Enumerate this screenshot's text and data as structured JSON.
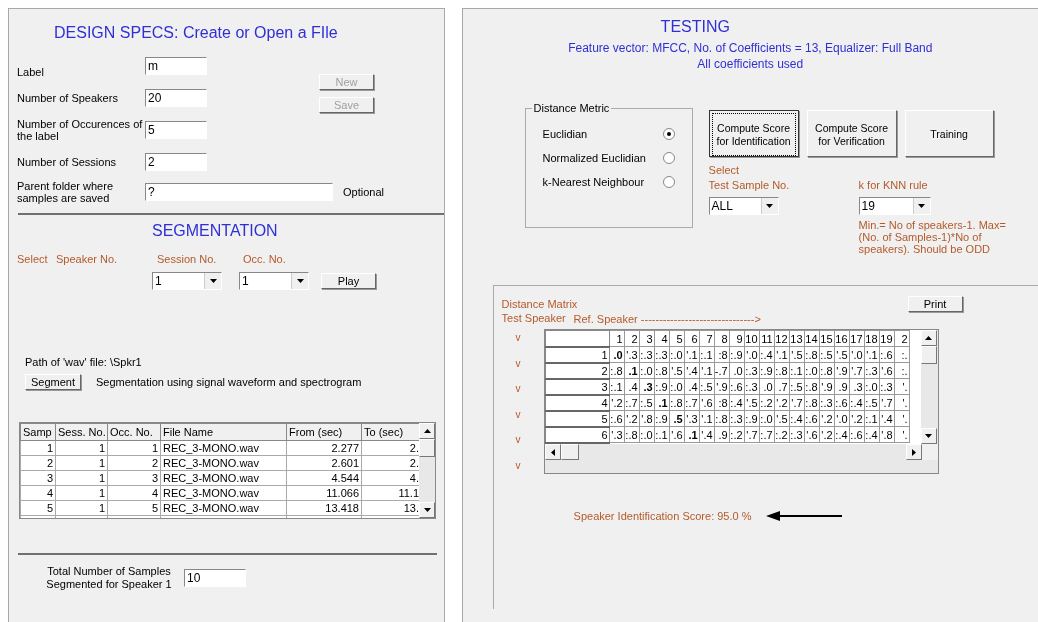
{
  "design_specs": {
    "title": "DESIGN SPECS: Create or Open a FIle",
    "fields": [
      {
        "label": "Label",
        "value": "m"
      },
      {
        "label": "Number of Speakers",
        "value": "20"
      },
      {
        "label": "Number of Occurences of the label",
        "value": "5"
      },
      {
        "label": "Number of Sessions",
        "value": "2"
      }
    ],
    "buttons": [
      {
        "label": "New",
        "disabled": true
      },
      {
        "label": "Save",
        "disabled": true
      }
    ],
    "parent_folder": {
      "label": "Parent folder where samples are saved",
      "value": "?",
      "note": "Optional"
    }
  },
  "segmentation": {
    "title": "SEGMENTATION",
    "select_label": "Select",
    "speaker_label": "Speaker No.",
    "session_label": "Session No.",
    "occ_label": "Occ. No.",
    "session_value": "1",
    "occ_value": "1",
    "play_button": "Play",
    "path_text": "Path of 'wav' file:  \\Spkr1",
    "segment_button": "Segment",
    "segment_note": "Segmentation using signal waveform and spectrogram",
    "table": {
      "columns": [
        "Samp",
        "Sess. No.",
        "Occ. No.",
        "File Name",
        "From (sec)",
        "To (sec)"
      ],
      "rows": [
        [
          "1",
          "1",
          "1",
          "REC_3-MONO.wav",
          "2.277",
          "2."
        ],
        [
          "2",
          "1",
          "2",
          "REC_3-MONO.wav",
          "2.601",
          "2."
        ],
        [
          "3",
          "1",
          "3",
          "REC_3-MONO.wav",
          "4.544",
          "4."
        ],
        [
          "4",
          "1",
          "4",
          "REC_3-MONO.wav",
          "11.066",
          "11.1"
        ],
        [
          "5",
          "1",
          "5",
          "REC_3-MONO.wav",
          "13.418",
          "13."
        ]
      ]
    },
    "total_label": "Total Number of Samples Segmented for Speaker 1",
    "total_value": "10"
  },
  "testing": {
    "title": "TESTING",
    "subtitle": "Feature vector: MFCC, No. of Coefficients = 13, Equalizer: Full Band",
    "subtitle2": "All coefficients used",
    "distance_metric": {
      "title": "Distance Metric",
      "options": [
        {
          "label": "Euclidian",
          "selected": true
        },
        {
          "label": "Normalized Euclidian",
          "selected": false
        },
        {
          "label": "k-Nearest Neighbour",
          "selected": false
        }
      ]
    },
    "buttons": [
      {
        "label": "Compute Score for Identification",
        "focused": true
      },
      {
        "label": "Compute Score for Verification",
        "focused": false
      },
      {
        "label": "Training",
        "focused": false
      }
    ],
    "select_label": "Select",
    "test_sample_label": "Test Sample No.",
    "test_sample_value": "ALL",
    "knn_label": "k for KNN rule",
    "knn_value": "19",
    "knn_note": "Min.= No of speakers-1. Max=(No. of Samples-1)*No of speakers). Should be ODD"
  },
  "distance_matrix": {
    "title": "Distance Matrix",
    "print_button": "Print",
    "test_speaker_label": "Test Speaker",
    "ref_speaker_label": "Ref. Speaker ------------------------------->",
    "markers": [
      "v",
      "v",
      "v",
      "v",
      "v",
      "v"
    ],
    "columns": [
      "1",
      "2",
      "3",
      "4",
      "5",
      "6",
      "7",
      "8",
      "9",
      "10",
      "11",
      "12",
      "13",
      "14",
      "15",
      "16",
      "17",
      "18",
      "19",
      "2"
    ],
    "rows": [
      {
        "label": "1",
        "cells": [
          {
            "t": ".0",
            "bold": true
          },
          {
            "t": "'.3",
            "bold": false
          },
          {
            "t": ":.3",
            "bold": false
          },
          {
            "t": ":.3",
            "bold": false
          },
          {
            "t": ":.0",
            "bold": false
          },
          {
            "t": "'.1",
            "bold": false
          },
          {
            "t": ":.1",
            "bold": false
          },
          {
            "t": ":8",
            "bold": false
          },
          {
            "t": ":.9",
            "bold": false
          },
          {
            "t": "'.0",
            "bold": false
          },
          {
            "t": ":.4",
            "bold": false
          },
          {
            "t": "'.1",
            "bold": false
          },
          {
            "t": "'.5",
            "bold": false
          },
          {
            "t": ":.8",
            "bold": false
          },
          {
            "t": ":.5",
            "bold": false
          },
          {
            "t": "'.5",
            "bold": false
          },
          {
            "t": "'.0",
            "bold": false
          },
          {
            "t": "'.1",
            "bold": false
          },
          {
            "t": ":.6",
            "bold": false
          },
          {
            "t": ":.",
            "bold": false
          }
        ]
      },
      {
        "label": "2",
        "cells": [
          {
            "t": ":.8",
            "bold": false
          },
          {
            "t": ".1",
            "bold": true
          },
          {
            "t": ":.0",
            "bold": false
          },
          {
            "t": ":.8",
            "bold": false
          },
          {
            "t": "'.5",
            "bold": false
          },
          {
            "t": "'.4",
            "bold": false
          },
          {
            "t": "'.1",
            "bold": false
          },
          {
            "t": "-.7",
            "bold": false
          },
          {
            "t": ".0",
            "bold": false
          },
          {
            "t": ":.3",
            "bold": false
          },
          {
            "t": ":.9",
            "bold": false
          },
          {
            "t": ":.8",
            "bold": false
          },
          {
            "t": ":.1",
            "bold": false
          },
          {
            "t": ":.0",
            "bold": false
          },
          {
            "t": ":.8",
            "bold": false
          },
          {
            "t": "'.9",
            "bold": false
          },
          {
            "t": "'.7",
            "bold": false
          },
          {
            "t": ":.3",
            "bold": false
          },
          {
            "t": "'.6",
            "bold": false
          },
          {
            "t": ":.",
            "bold": false
          }
        ]
      },
      {
        "label": "3",
        "cells": [
          {
            "t": ":.1",
            "bold": false
          },
          {
            "t": ".4",
            "bold": false
          },
          {
            "t": ".3",
            "bold": true
          },
          {
            "t": ":.9",
            "bold": false
          },
          {
            "t": ":.0",
            "bold": false
          },
          {
            "t": ".4",
            "bold": false
          },
          {
            "t": ":.5",
            "bold": false
          },
          {
            "t": "'.9",
            "bold": false
          },
          {
            "t": ":.6",
            "bold": false
          },
          {
            "t": ":.3",
            "bold": false
          },
          {
            "t": ".0",
            "bold": false
          },
          {
            "t": ".7",
            "bold": false
          },
          {
            "t": ":.5",
            "bold": false
          },
          {
            "t": ":.8",
            "bold": false
          },
          {
            "t": "'.9",
            "bold": false
          },
          {
            "t": ".9",
            "bold": false
          },
          {
            "t": ".3",
            "bold": false
          },
          {
            "t": ":.0",
            "bold": false
          },
          {
            "t": ":.3",
            "bold": false
          },
          {
            "t": "'.",
            "bold": false
          }
        ]
      },
      {
        "label": "4",
        "cells": [
          {
            "t": "'.2",
            "bold": false
          },
          {
            "t": ":.7",
            "bold": false
          },
          {
            "t": ":.5",
            "bold": false
          },
          {
            "t": ".1",
            "bold": true
          },
          {
            "t": ":.8",
            "bold": false
          },
          {
            "t": ":.7",
            "bold": false
          },
          {
            "t": "'.6",
            "bold": false
          },
          {
            "t": ":8",
            "bold": false
          },
          {
            "t": ":.4",
            "bold": false
          },
          {
            "t": "'.5",
            "bold": false
          },
          {
            "t": ":.2",
            "bold": false
          },
          {
            "t": "'.2",
            "bold": false
          },
          {
            "t": "'.7",
            "bold": false
          },
          {
            "t": ":.8",
            "bold": false
          },
          {
            "t": ":.3",
            "bold": false
          },
          {
            "t": ":.6",
            "bold": false
          },
          {
            "t": ":.4",
            "bold": false
          },
          {
            "t": ":.5",
            "bold": false
          },
          {
            "t": "'.7",
            "bold": false
          },
          {
            "t": "'.",
            "bold": false
          }
        ]
      },
      {
        "label": "5",
        "cells": [
          {
            "t": ":.6",
            "bold": false
          },
          {
            "t": "'.2",
            "bold": false
          },
          {
            "t": "'.8",
            "bold": false
          },
          {
            "t": ":.9",
            "bold": false
          },
          {
            "t": ".5",
            "bold": true
          },
          {
            "t": "'.3",
            "bold": false
          },
          {
            "t": "'.1",
            "bold": false
          },
          {
            "t": ":.8",
            "bold": false
          },
          {
            "t": ":.3",
            "bold": false
          },
          {
            "t": ":.9",
            "bold": false
          },
          {
            "t": ":.0",
            "bold": false
          },
          {
            "t": "'.5",
            "bold": false
          },
          {
            "t": ":.4",
            "bold": false
          },
          {
            "t": ":.6",
            "bold": false
          },
          {
            "t": "'.2",
            "bold": false
          },
          {
            "t": "'.0",
            "bold": false
          },
          {
            "t": "'.2",
            "bold": false
          },
          {
            "t": ":.1",
            "bold": false
          },
          {
            "t": "'.4",
            "bold": false
          },
          {
            "t": "'.",
            "bold": false
          }
        ]
      },
      {
        "label": "6",
        "cells": [
          {
            "t": "'.3",
            "bold": false
          },
          {
            "t": ":.8",
            "bold": false
          },
          {
            "t": ":.0",
            "bold": false
          },
          {
            "t": ":.1",
            "bold": false
          },
          {
            "t": "'.6",
            "bold": false
          },
          {
            "t": ".1",
            "bold": true
          },
          {
            "t": "'.4",
            "bold": false
          },
          {
            "t": ".9",
            "bold": false
          },
          {
            "t": ":.2",
            "bold": false
          },
          {
            "t": "'.7",
            "bold": false
          },
          {
            "t": ":.7",
            "bold": false
          },
          {
            "t": ":.2",
            "bold": false
          },
          {
            "t": ":.3",
            "bold": false
          },
          {
            "t": "'.6",
            "bold": false
          },
          {
            "t": "'.2",
            "bold": false
          },
          {
            "t": ":.4",
            "bold": false
          },
          {
            "t": ":.6",
            "bold": false
          },
          {
            "t": ":.4",
            "bold": false
          },
          {
            "t": "'.8",
            "bold": false
          },
          {
            "t": "'.",
            "bold": false
          }
        ]
      }
    ],
    "score_text": "Speaker Identification Score: 95.0 %"
  }
}
